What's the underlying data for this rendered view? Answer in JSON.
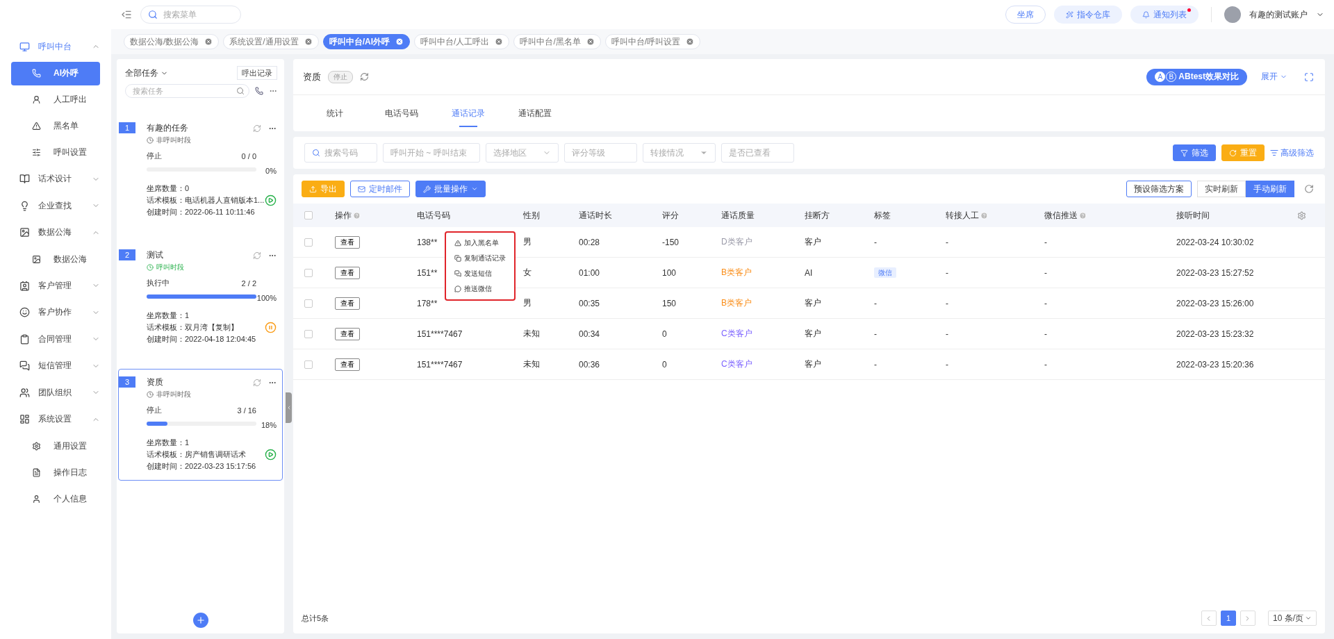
{
  "topbar": {
    "search_placeholder": "搜索菜单",
    "buttons": [
      {
        "label": "坐席",
        "kind": "outline",
        "badge": false
      },
      {
        "label": "指令仓库",
        "kind": "soft",
        "badge": false
      },
      {
        "label": "通知列表",
        "kind": "soft",
        "badge": true
      }
    ],
    "user": "有趣的测试账户"
  },
  "open_tabs": [
    {
      "label": "数据公海/数据公海",
      "selected": false
    },
    {
      "label": "系统设置/通用设置",
      "selected": false
    },
    {
      "label": "呼叫中台/AI外呼",
      "selected": true
    },
    {
      "label": "呼叫中台/人工呼出",
      "selected": false
    },
    {
      "label": "呼叫中台/黑名单",
      "selected": false
    },
    {
      "label": "呼叫中台/呼叫设置",
      "selected": false
    }
  ],
  "sidebar": {
    "items": [
      {
        "label": "呼叫中台",
        "selected": true,
        "expanded": true,
        "children": [
          {
            "label": "AI外呼",
            "selected": true
          },
          {
            "label": "人工呼出",
            "selected": false
          },
          {
            "label": "黑名单",
            "selected": false
          },
          {
            "label": "呼叫设置",
            "selected": false
          }
        ]
      },
      {
        "label": "话术设计",
        "selected": false,
        "expanded": false
      },
      {
        "label": "企业查找",
        "selected": false,
        "expanded": false
      },
      {
        "label": "数据公海",
        "selected": false,
        "expanded": true,
        "children": [
          {
            "label": "数据公海",
            "selected": false
          }
        ]
      },
      {
        "label": "客户管理",
        "selected": false,
        "expanded": false
      },
      {
        "label": "客户协作",
        "selected": false,
        "expanded": false
      },
      {
        "label": "合同管理",
        "selected": false,
        "expanded": false
      },
      {
        "label": "短信管理",
        "selected": false,
        "expanded": false
      },
      {
        "label": "团队组织",
        "selected": false,
        "expanded": false
      },
      {
        "label": "系统设置",
        "selected": false,
        "expanded": true,
        "children": [
          {
            "label": "通用设置",
            "selected": false
          },
          {
            "label": "操作日志",
            "selected": false
          },
          {
            "label": "个人信息",
            "selected": false
          }
        ]
      }
    ]
  },
  "task_panel": {
    "filter": "全部任务",
    "records_button": "呼出记录",
    "search_placeholder": "搜索任务",
    "tasks": [
      {
        "number": "1",
        "name": "有趣的任务",
        "in_period": false,
        "period": "非呼叫时段",
        "state": "停止",
        "count": "0 / 0",
        "percent": "0%",
        "level": 0,
        "details": [
          "坐席数量：0",
          "话术模板：电话机器人直销版本1...",
          "创建时间：2022-06-11 10:11:46"
        ],
        "running": false,
        "selected": false
      },
      {
        "number": "2",
        "name": "测试",
        "in_period": true,
        "period": "呼叫时段",
        "state": "执行中",
        "count": "2 / 2",
        "percent": "100%",
        "level": 1,
        "details": [
          "坐席数量：1",
          "话术模板：双月湾【复制】",
          "创建时间：2022-04-18 12:04:45"
        ],
        "running": true,
        "selected": false
      },
      {
        "number": "3",
        "name": "资质",
        "in_period": false,
        "period": "非呼叫时段",
        "state": "停止",
        "count": "3 / 16",
        "percent": "18%",
        "level": 0.1875,
        "details": [
          "坐席数量：1",
          "话术模板：房产销售调研话术",
          "创建时间：2022-03-23 15:17:56"
        ],
        "running": false,
        "selected": true
      }
    ]
  },
  "main": {
    "title": "资质",
    "status": "停止",
    "ab_marks": [
      "A",
      "B"
    ],
    "ab_button": "ABtest效果对比",
    "expand": "展开",
    "tabs": [
      {
        "label": "统计",
        "selected": false
      },
      {
        "label": "电话号码",
        "selected": false
      },
      {
        "label": "通话记录",
        "selected": true
      },
      {
        "label": "通话配置",
        "selected": false
      }
    ],
    "filters": [
      {
        "kind": "search",
        "placeholder": "搜索号码"
      },
      {
        "kind": "input",
        "placeholder": "呼叫开始 ~ 呼叫结束"
      },
      {
        "kind": "select",
        "placeholder": "选择地区"
      },
      {
        "kind": "input",
        "placeholder": "评分等级"
      },
      {
        "kind": "caret",
        "placeholder": "转接情况"
      },
      {
        "kind": "input",
        "placeholder": "是否已查看"
      }
    ],
    "filter_buttons": {
      "apply": "筛选",
      "reset": "重置",
      "advanced": "高级筛选"
    },
    "toolbar": {
      "export": "导出",
      "mail": "定时邮件",
      "batch": "批量操作",
      "preset": "预设筛选方案",
      "refresh_modes": [
        {
          "label": "实时刷新",
          "selected": false
        },
        {
          "label": "手动刷新",
          "selected": true
        }
      ]
    },
    "table": {
      "all_checked": false,
      "columns": [
        {
          "label": "操作",
          "help": true
        },
        {
          "label": "电话号码",
          "help": false
        },
        {
          "label": "性别",
          "help": false
        },
        {
          "label": "通话时长",
          "help": false
        },
        {
          "label": "评分",
          "help": false
        },
        {
          "label": "通话质量",
          "help": false
        },
        {
          "label": "挂断方",
          "help": false
        },
        {
          "label": "标签",
          "help": false
        },
        {
          "label": "转接人工",
          "help": true
        },
        {
          "label": "微信推送",
          "help": true
        },
        {
          "label": "接听时间",
          "help": false
        }
      ],
      "rows": [
        {
          "checked": false,
          "action": "查看",
          "phone": "138**",
          "gender": "男",
          "duration": "00:28",
          "score": "-150",
          "quality": {
            "text": "D类客户",
            "color": "#9a9aa8"
          },
          "hangup": "客户",
          "tag": "-",
          "tag_chip": false,
          "transfer": "-",
          "wechat": "-",
          "time": "2022-03-24 10:30:02"
        },
        {
          "checked": false,
          "action": "查看",
          "phone": "151**",
          "gender": "女",
          "duration": "01:00",
          "score": "100",
          "quality": {
            "text": "B类客户",
            "color": "#fa8c16"
          },
          "hangup": "AI",
          "tag": "微信",
          "tag_chip": true,
          "transfer": "-",
          "wechat": "-",
          "time": "2022-03-23 15:27:52"
        },
        {
          "checked": false,
          "action": "查看",
          "phone": "178**",
          "gender": "男",
          "duration": "00:35",
          "score": "150",
          "quality": {
            "text": "B类客户",
            "color": "#fa8c16"
          },
          "hangup": "客户",
          "tag": "-",
          "tag_chip": false,
          "transfer": "-",
          "wechat": "-",
          "time": "2022-03-23 15:26:00"
        },
        {
          "checked": false,
          "action": "查看",
          "phone": "151****7467",
          "gender": "未知",
          "duration": "00:34",
          "score": "0",
          "quality": {
            "text": "C类客户",
            "color": "#7b61ff"
          },
          "hangup": "客户",
          "tag": "-",
          "tag_chip": false,
          "transfer": "-",
          "wechat": "-",
          "time": "2022-03-23 15:23:32"
        },
        {
          "checked": false,
          "action": "查看",
          "phone": "151****7467",
          "gender": "未知",
          "duration": "00:36",
          "score": "0",
          "quality": {
            "text": "C类客户",
            "color": "#7b61ff"
          },
          "hangup": "客户",
          "tag": "-",
          "tag_chip": false,
          "transfer": "-",
          "wechat": "-",
          "time": "2022-03-23 15:20:36"
        }
      ]
    },
    "context_menu": [
      "加入黑名单",
      "复制通话记录",
      "发送短信",
      "推送微信"
    ],
    "footer": {
      "total": "总计5条",
      "pages": [
        {
          "label": "1",
          "selected": true
        }
      ],
      "page_size": "10 条/页"
    }
  }
}
